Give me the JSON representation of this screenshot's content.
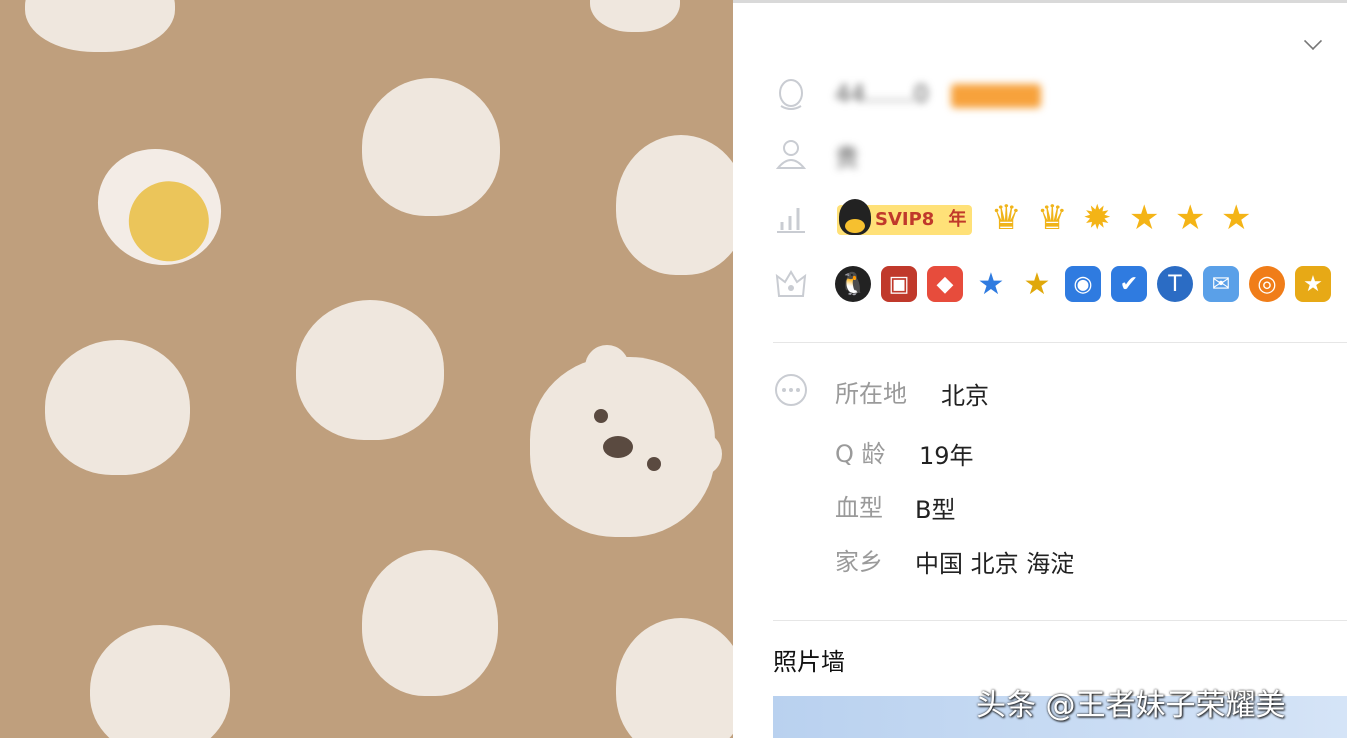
{
  "profile": {
    "account_number": "44……0",
    "nickname": "贵",
    "vip_label": "SVIP8",
    "vip_year": "年",
    "location_label": "所在地",
    "location_value": "北京",
    "qage_label": "Q 龄",
    "qage_value": "19年",
    "blood_label": "血型",
    "blood_value": "B型",
    "hometown_label": "家乡",
    "hometown_value": "中国 北京 海淀",
    "photo_wall_title": "照片墙"
  },
  "level_icons": [
    "crown-icon",
    "crown-icon",
    "sun-icon",
    "star-icon",
    "star-icon",
    "star-icon"
  ],
  "service_icons": [
    "qq-vip-icon",
    "game-icon",
    "diamond-icon",
    "star-blue-icon",
    "star-gold-icon",
    "camera-icon",
    "shield-icon",
    "security-icon",
    "mail-icon",
    "music-icon",
    "medal-icon"
  ],
  "watermark": "头条 @王者妹子荣耀美",
  "colors": {
    "background": "#bf9f7d",
    "bun": "#efe7de",
    "vip": "#ffe178",
    "star": "#f4b416"
  }
}
